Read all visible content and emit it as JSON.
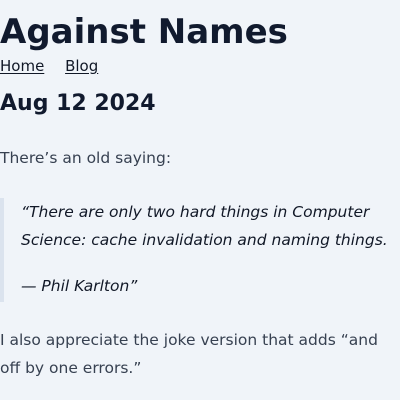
{
  "site": {
    "title": "Against Names"
  },
  "nav": {
    "home": "Home",
    "blog": "Blog"
  },
  "post": {
    "date": "Aug 12 2024",
    "intro": "There’s an old saying:",
    "quote": {
      "text": "“There are only two hard things in Computer Science: cache invalidation and naming things.",
      "attribution": "— Phil Karlton”"
    },
    "joke": "I also appreciate the joke version that adds “and off by one errors.”"
  }
}
